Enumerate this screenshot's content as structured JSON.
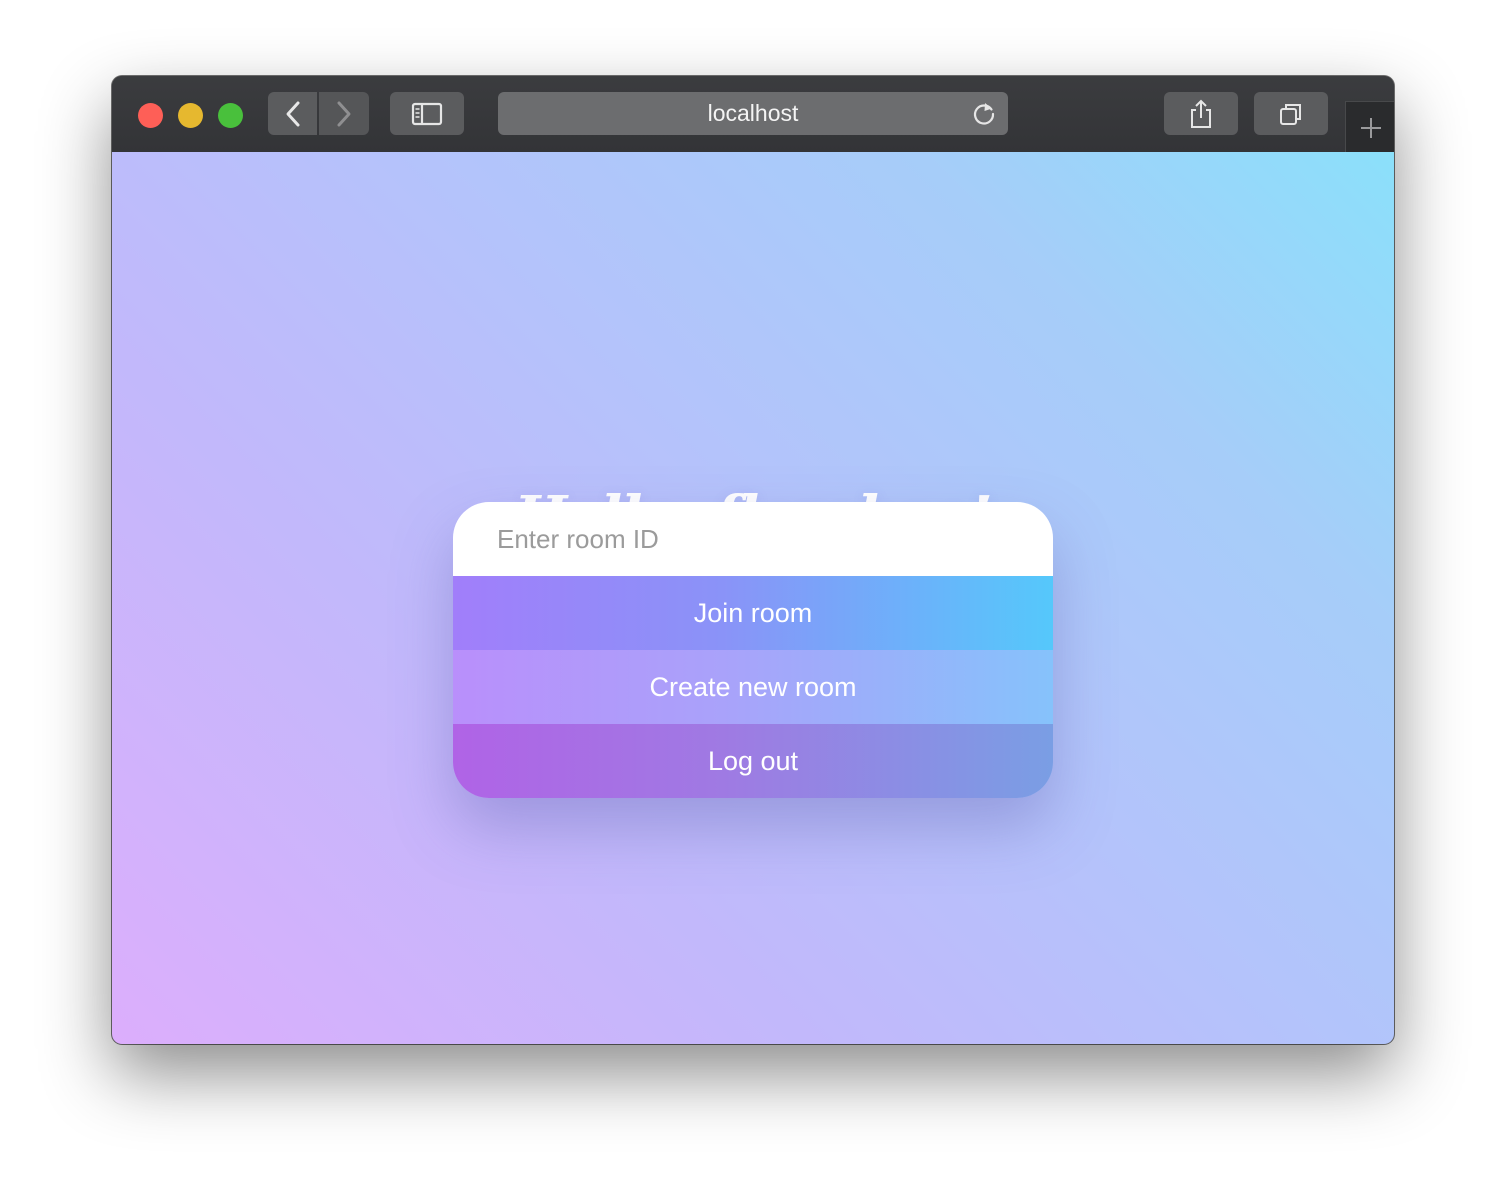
{
  "browser": {
    "url": "localhost",
    "back_label": "‹",
    "forward_label": "›"
  },
  "page": {
    "greeting": "Hello, flerokoo!",
    "room_input": {
      "value": "",
      "placeholder": "Enter room ID"
    },
    "buttons": {
      "join": "Join room",
      "create": "Create new room",
      "logout": "Log out"
    }
  },
  "colors": {
    "traffic_red": "#fe5f57",
    "traffic_yellow": "#e6b82f",
    "traffic_green": "#49c03c",
    "gradient_start": "#dcaefc",
    "gradient_end": "#8be0fa"
  },
  "icons": [
    "back-chevron-icon",
    "forward-chevron-icon",
    "sidebar-icon",
    "reload-icon",
    "share-icon",
    "tabs-icon",
    "plus-icon"
  ]
}
